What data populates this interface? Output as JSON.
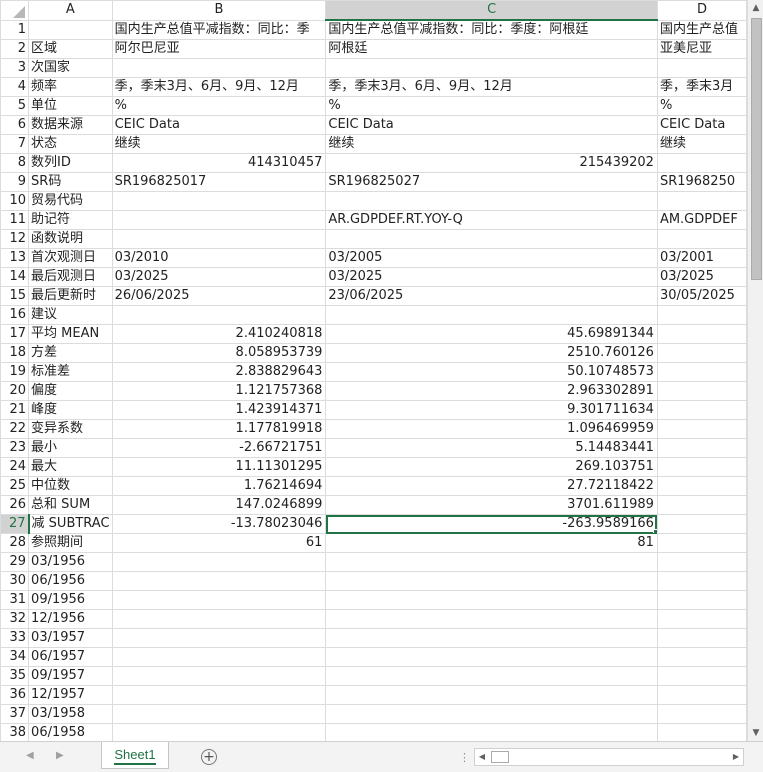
{
  "columns": [
    "A",
    "B",
    "C",
    "D"
  ],
  "selected_column": "C",
  "selected_row": "27",
  "rows": [
    {
      "n": "1",
      "a": "",
      "b": "国内生产总值平减指数：同比：季",
      "c": "国内生产总值平减指数：同比：季度：阿根廷",
      "d": "国内生产总值"
    },
    {
      "n": "2",
      "a": "区域",
      "b": "阿尔巴尼亚",
      "c": "阿根廷",
      "d": "亚美尼亚"
    },
    {
      "n": "3",
      "a": "次国家",
      "b": "",
      "c": "",
      "d": ""
    },
    {
      "n": "4",
      "a": "频率",
      "b": "季，季末3月、6月、9月、12月",
      "c": "季，季末3月、6月、9月、12月",
      "d": "季，季末3月"
    },
    {
      "n": "5",
      "a": "单位",
      "b": "%",
      "c": "%",
      "d": "%"
    },
    {
      "n": "6",
      "a": "数据来源",
      "b": "CEIC Data",
      "c": "CEIC Data",
      "d": "CEIC Data"
    },
    {
      "n": "7",
      "a": "状态",
      "b": "继续",
      "c": "继续",
      "d": "继续"
    },
    {
      "n": "8",
      "a": "数列ID",
      "b": "414310457",
      "c": "215439202",
      "d": "",
      "num": true
    },
    {
      "n": "9",
      "a": "SR码",
      "b": "SR196825017",
      "c": "SR196825027",
      "d": "SR1968250"
    },
    {
      "n": "10",
      "a": "贸易代码",
      "b": "",
      "c": "",
      "d": ""
    },
    {
      "n": "11",
      "a": "助记符",
      "b": "",
      "c": "AR.GDPDEF.RT.YOY-Q",
      "d": "AM.GDPDEF"
    },
    {
      "n": "12",
      "a": "函数说明",
      "b": "",
      "c": "",
      "d": ""
    },
    {
      "n": "13",
      "a": "首次观测日",
      "b": "03/2010",
      "c": "03/2005",
      "d": "03/2001"
    },
    {
      "n": "14",
      "a": "最后观测日",
      "b": "03/2025",
      "c": "03/2025",
      "d": "03/2025"
    },
    {
      "n": "15",
      "a": "最后更新时",
      "b": "26/06/2025",
      "c": "23/06/2025",
      "d": "30/05/2025"
    },
    {
      "n": "16",
      "a": "建议",
      "b": "",
      "c": "",
      "d": ""
    },
    {
      "n": "17",
      "a": "平均 MEAN",
      "b": "2.410240818",
      "c": "45.69891344",
      "d": "",
      "num": true
    },
    {
      "n": "18",
      "a": "方差",
      "b": "8.058953739",
      "c": "2510.760126",
      "d": "",
      "num": true
    },
    {
      "n": "19",
      "a": "标准差",
      "b": "2.838829643",
      "c": "50.10748573",
      "d": "",
      "num": true
    },
    {
      "n": "20",
      "a": "偏度",
      "b": "1.121757368",
      "c": "2.963302891",
      "d": "",
      "num": true
    },
    {
      "n": "21",
      "a": "峰度",
      "b": "1.423914371",
      "c": "9.301711634",
      "d": "",
      "num": true
    },
    {
      "n": "22",
      "a": "变异系数",
      "b": "1.177819918",
      "c": "1.096469959",
      "d": "",
      "num": true
    },
    {
      "n": "23",
      "a": "最小",
      "b": "-2.66721751",
      "c": "5.14483441",
      "d": "",
      "num": true
    },
    {
      "n": "24",
      "a": "最大",
      "b": "11.11301295",
      "c": "269.103751",
      "d": "",
      "num": true
    },
    {
      "n": "25",
      "a": "中位数",
      "b": "1.76214694",
      "c": "27.72118422",
      "d": "",
      "num": true
    },
    {
      "n": "26",
      "a": "总和 SUM",
      "b": "147.0246899",
      "c": "3701.611989",
      "d": "",
      "num": true
    },
    {
      "n": "27",
      "a": "减 SUBTRAC",
      "b": "-13.78023046",
      "c": "-263.9589166",
      "d": "",
      "num": true
    },
    {
      "n": "28",
      "a": "参照期间",
      "b": "61",
      "c": "81",
      "d": "",
      "num": true
    },
    {
      "n": "29",
      "a": "03/1956",
      "b": "",
      "c": "",
      "d": ""
    },
    {
      "n": "30",
      "a": "06/1956",
      "b": "",
      "c": "",
      "d": ""
    },
    {
      "n": "31",
      "a": "09/1956",
      "b": "",
      "c": "",
      "d": ""
    },
    {
      "n": "32",
      "a": "12/1956",
      "b": "",
      "c": "",
      "d": ""
    },
    {
      "n": "33",
      "a": "03/1957",
      "b": "",
      "c": "",
      "d": ""
    },
    {
      "n": "34",
      "a": "06/1957",
      "b": "",
      "c": "",
      "d": ""
    },
    {
      "n": "35",
      "a": "09/1957",
      "b": "",
      "c": "",
      "d": ""
    },
    {
      "n": "36",
      "a": "12/1957",
      "b": "",
      "c": "",
      "d": ""
    },
    {
      "n": "37",
      "a": "03/1958",
      "b": "",
      "c": "",
      "d": ""
    },
    {
      "n": "38",
      "a": "06/1958",
      "b": "",
      "c": "",
      "d": ""
    }
  ],
  "sheet_tabs": [
    "Sheet1"
  ],
  "colors": {
    "accent": "#217346",
    "gridline": "#dadcdd",
    "header_selected": "#d2d2d2"
  },
  "icons": {
    "add_sheet": "plus-circle-icon",
    "nav_prev": "triangle-left-icon",
    "nav_next": "triangle-right-icon"
  }
}
